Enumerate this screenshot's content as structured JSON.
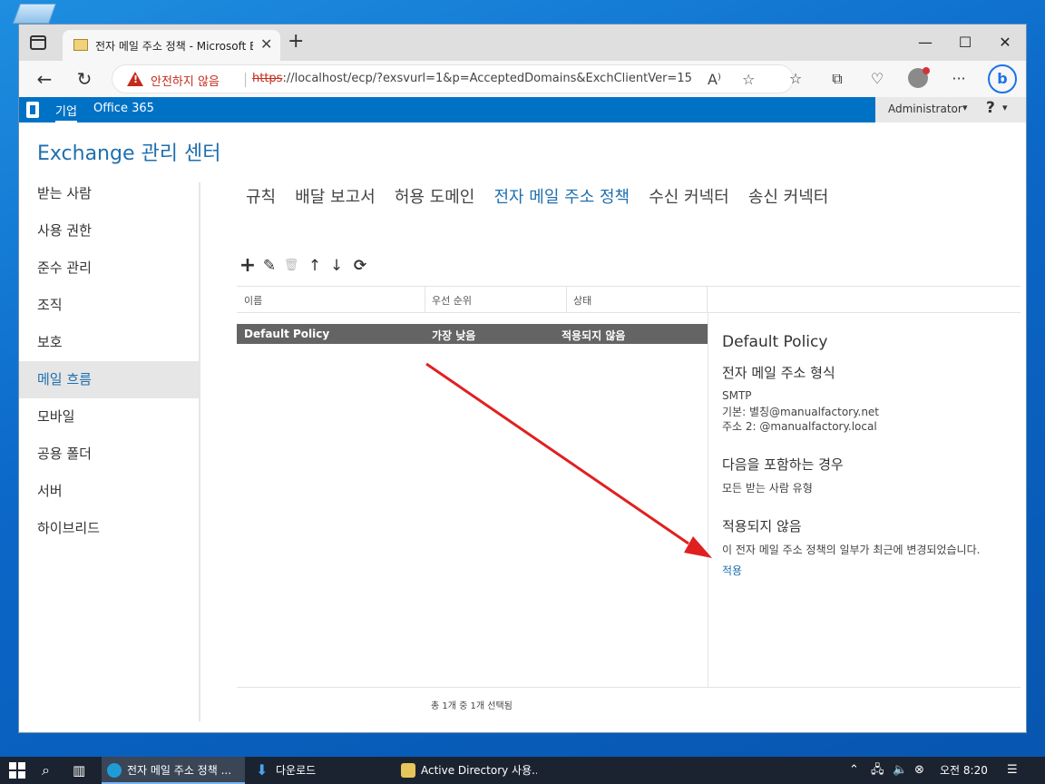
{
  "browser": {
    "tab_title": "전자 메일 주소 정책 - Microsoft Exchange",
    "tab_close": "✕",
    "new_tab": "+",
    "security_warning": "안전하지 않음",
    "url_scheme": "https",
    "url_rest": "://localhost/ecp/?exsvurl=1&p=AcceptedDomains&ExchClientVer=15",
    "read_aloud": "A⁾",
    "more": "···",
    "bing": "b"
  },
  "suitebar": {
    "enterprise": "기업",
    "office365": "Office 365",
    "user": "Administrator",
    "caret": "▾",
    "help": "?"
  },
  "eac": {
    "title": "Exchange 관리 센터"
  },
  "nav": {
    "items": [
      "받는 사람",
      "사용 권한",
      "준수 관리",
      "조직",
      "보호",
      "메일 흐름",
      "모바일",
      "공용 폴더",
      "서버",
      "하이브리드"
    ],
    "active": "메일 흐름"
  },
  "subtabs": [
    "규칙",
    "배달 보고서",
    "허용 도메인",
    "전자 메일 주소 정책",
    "수신 커넥터",
    "송신 커넥터"
  ],
  "toolbar": {
    "add": "+",
    "edit": "✎",
    "delete": "🗑",
    "up": "↑",
    "down": "↓",
    "refresh": "⟳"
  },
  "grid": {
    "columns": [
      "이름",
      "우선 순위",
      "상태"
    ],
    "rows": [
      {
        "name": "Default Policy",
        "priority": "가장 낮음",
        "status": "적용되지 않음"
      }
    ],
    "footer": "총 1개 중 1개 선택됨"
  },
  "detail": {
    "title": "Default Policy",
    "format_heading": "전자 메일 주소 형식",
    "format_type": "SMTP",
    "format_primary": "기본: 별칭@manualfactory.net",
    "format_secondary": "주소 2: @manualfactory.local",
    "includes_heading": "다음을 포함하는 경우",
    "includes_value": "모든 받는 사람 유형",
    "state_heading": "적용되지 않음",
    "state_text": "이 전자 메일 주소 정책의 일부가 최근에 변경되었습니다.",
    "apply_link": "적용"
  },
  "annotation": {
    "arrow_color": "#e02020"
  },
  "taskbar": {
    "apps": [
      {
        "label": "전자 메일 주소 정책 ...",
        "active": true
      },
      {
        "label": "다운로드",
        "active": false
      },
      {
        "label": "Active Directory 사용...",
        "active": false
      }
    ],
    "clock": "오전 8:20"
  },
  "colors": {
    "suitebar": "#0072c6",
    "accent": "#1f6fae",
    "selected_row": "#646464",
    "warning": "#c42b1c"
  }
}
